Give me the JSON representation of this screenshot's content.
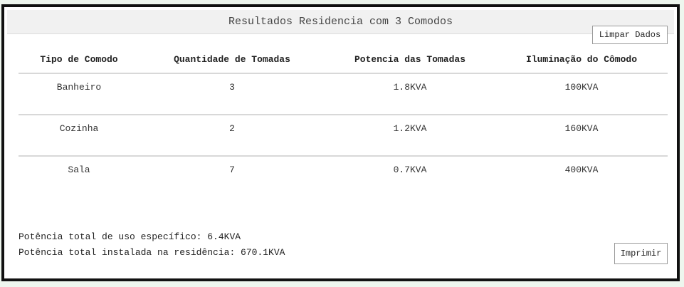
{
  "panel": {
    "title": "Resultados Residencia com 3 Comodos",
    "clear_button": "Limpar Dados",
    "print_button": "Imprimir"
  },
  "table": {
    "headers": {
      "tipo": "Tipo de Comodo",
      "quantidade": "Quantidade de Tomadas",
      "potencia": "Potencia das Tomadas",
      "iluminacao": "Iluminação do Cômodo"
    },
    "rows": [
      {
        "tipo": "Banheiro",
        "quantidade": "3",
        "potencia": "1.8KVA",
        "iluminacao": "100KVA"
      },
      {
        "tipo": "Cozinha",
        "quantidade": "2",
        "potencia": "1.2KVA",
        "iluminacao": "160KVA"
      },
      {
        "tipo": "Sala",
        "quantidade": "7",
        "potencia": "0.7KVA",
        "iluminacao": "400KVA"
      }
    ]
  },
  "summary": {
    "specific_use": "Potência total de uso específico: 6.4KVA",
    "installed": "Potência total instalada na residência: 670.1KVA"
  }
}
